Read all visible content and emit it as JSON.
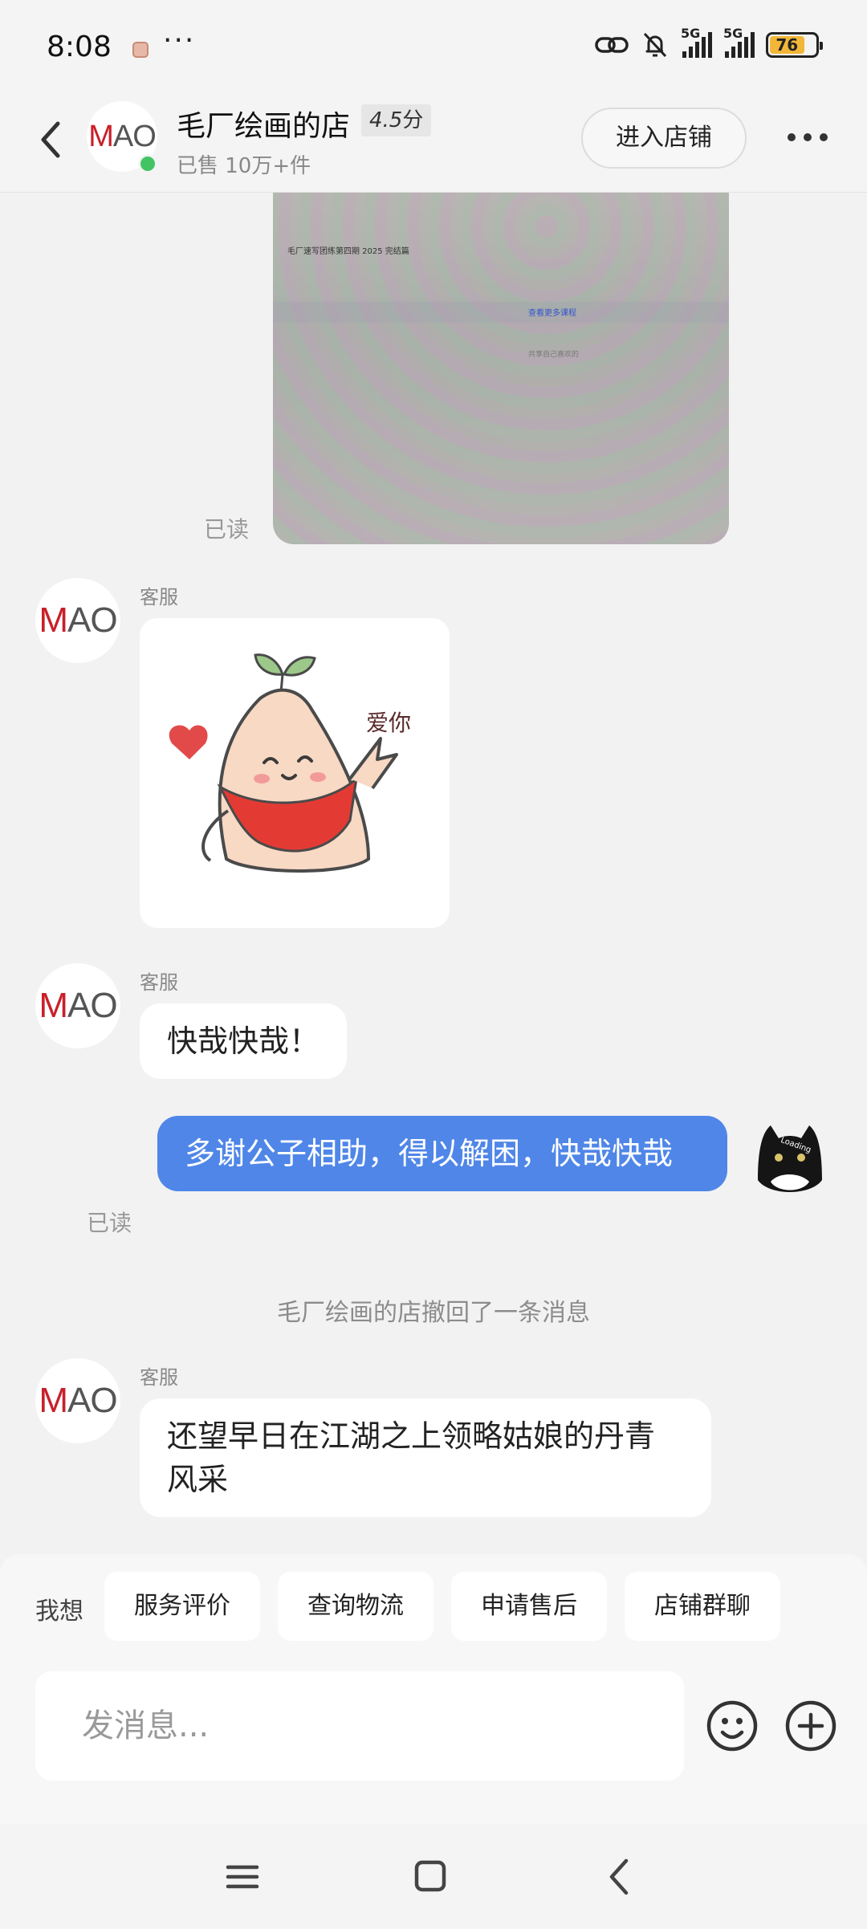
{
  "status_bar": {
    "time": "8:08",
    "more": "···",
    "net1": "5G",
    "net2": "5G",
    "battery": "76"
  },
  "header": {
    "back_icon": "chevron-left-icon",
    "logo_m": "M",
    "logo_ao": "AO",
    "shop_name": "毛厂绘画的店",
    "rating": "4.5",
    "rating_unit": "分",
    "sold": "已售 10万+件",
    "enter_store": "进入店铺",
    "more_icon": "more-dots-icon",
    "online_color": "#43c463"
  },
  "chat": {
    "photo_texts": {
      "title": "毛厂速写团练第四期 2025 完结篇",
      "link": "查看更多课程",
      "hint": "共享自己喜欢的"
    },
    "read_label": "已读",
    "sender_label": "客服",
    "sticker_text": "爱你",
    "messages": {
      "agent_1": "快哉快哉！",
      "user_1": "多谢公子相助，得以解困，快哉快哉",
      "system": "毛厂绘画的店撤回了一条消息",
      "agent_2": "还望早日在江湖之上领略姑娘的丹青风采"
    },
    "user_avatar_text": "Loading",
    "bubble_out_color": "#4f86e8"
  },
  "quick_actions": {
    "label": "我想",
    "chips": [
      "服务评价",
      "查询物流",
      "申请售后",
      "店铺群聊"
    ]
  },
  "input": {
    "placeholder": "发消息...",
    "value": "",
    "emoji_icon": "emoji-smile-icon",
    "plus_icon": "plus-circle-icon"
  },
  "nav": {
    "menu_icon": "menu-icon",
    "home_icon": "home-square-icon",
    "back_icon": "back-triangle-icon"
  }
}
